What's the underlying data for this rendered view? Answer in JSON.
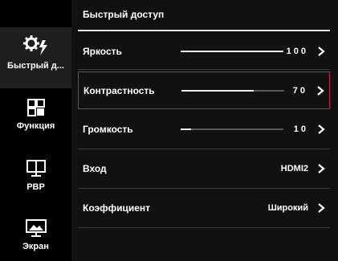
{
  "sidebar": {
    "items": [
      {
        "label": "Быстрый д...",
        "icon": "gears-lightning-icon",
        "active": true
      },
      {
        "label": "Функция",
        "icon": "grid-icon",
        "active": false
      },
      {
        "label": "PBP",
        "icon": "dual-monitor-icon",
        "active": false
      },
      {
        "label": "Экран",
        "icon": "monitor-picture-icon",
        "active": false
      }
    ]
  },
  "header": {
    "title": "Быстрый доступ"
  },
  "menu": {
    "items": [
      {
        "label": "Яркость",
        "value": "100",
        "level": 100,
        "kind": "slider"
      },
      {
        "label": "Контрастность",
        "value": "70",
        "level": 70,
        "kind": "slider",
        "selected": true
      },
      {
        "label": "Громкость",
        "value": "10",
        "level": 10,
        "kind": "slider"
      },
      {
        "label": "Вход",
        "value": "HDMI2",
        "kind": "text"
      },
      {
        "label": "Коэффициент",
        "value": "Широкий",
        "kind": "text"
      }
    ]
  },
  "colors": {
    "selection": "#c0244a",
    "track": "#5a5a5a",
    "fill": "#f0f0f0"
  }
}
